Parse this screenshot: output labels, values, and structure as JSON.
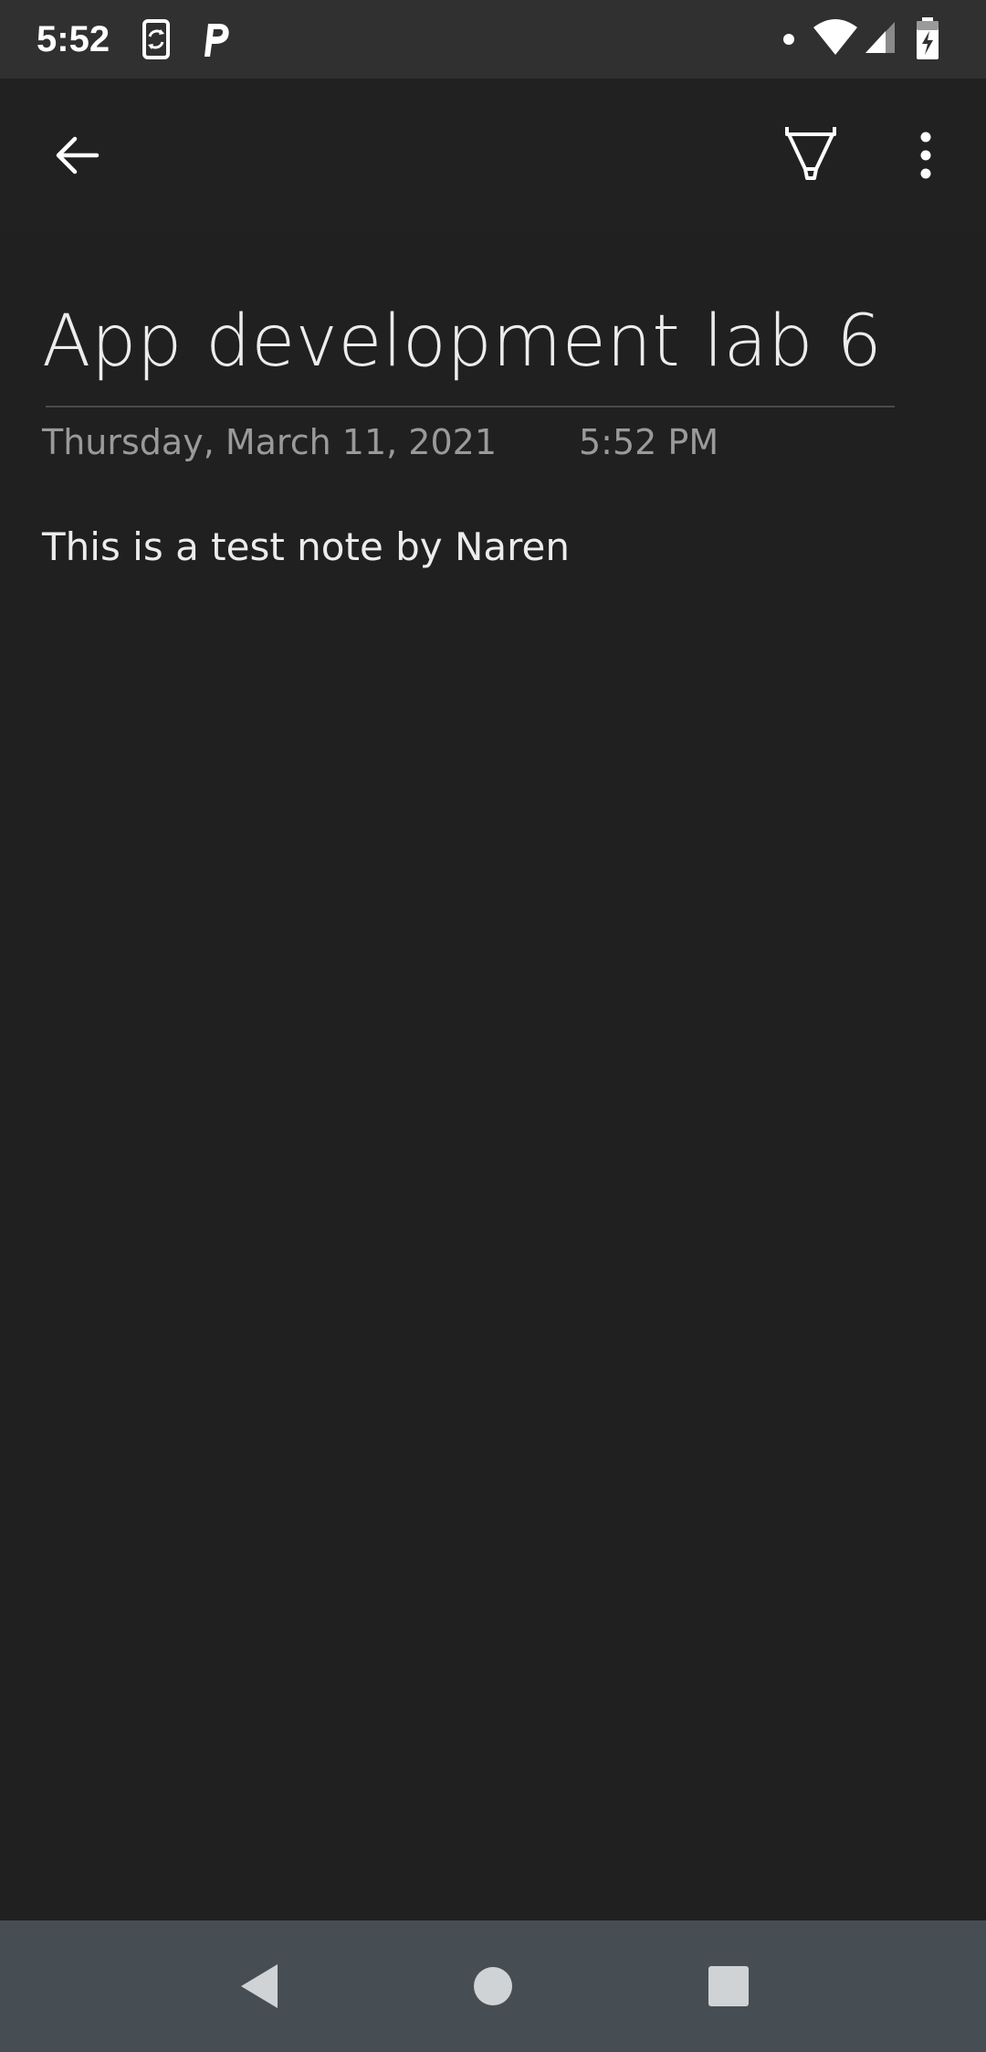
{
  "status_bar": {
    "time": "5:52",
    "icons": [
      "screen-rotation-icon",
      "parking-app-icon",
      "notification-dot-icon",
      "wifi-icon",
      "cellular-signal-icon",
      "battery-charging-icon"
    ]
  },
  "toolbar": {
    "icons": [
      "back-arrow-icon",
      "highlighter-pen-icon",
      "more-options-icon"
    ]
  },
  "note": {
    "title": "App development lab 6",
    "date": "Thursday, March 11, 2021",
    "time": "5:52 PM",
    "body": "This is a test note by Naren"
  },
  "nav_bar": {
    "icons": [
      "nav-back-icon",
      "nav-home-icon",
      "nav-recents-icon"
    ]
  },
  "colors": {
    "status_bar_bg": "#303030",
    "toolbar_bg": "#212121",
    "content_bg": "#202020",
    "nav_bar_bg": "#474e53",
    "text_primary": "#ececec",
    "text_secondary": "#9a9a9a"
  }
}
